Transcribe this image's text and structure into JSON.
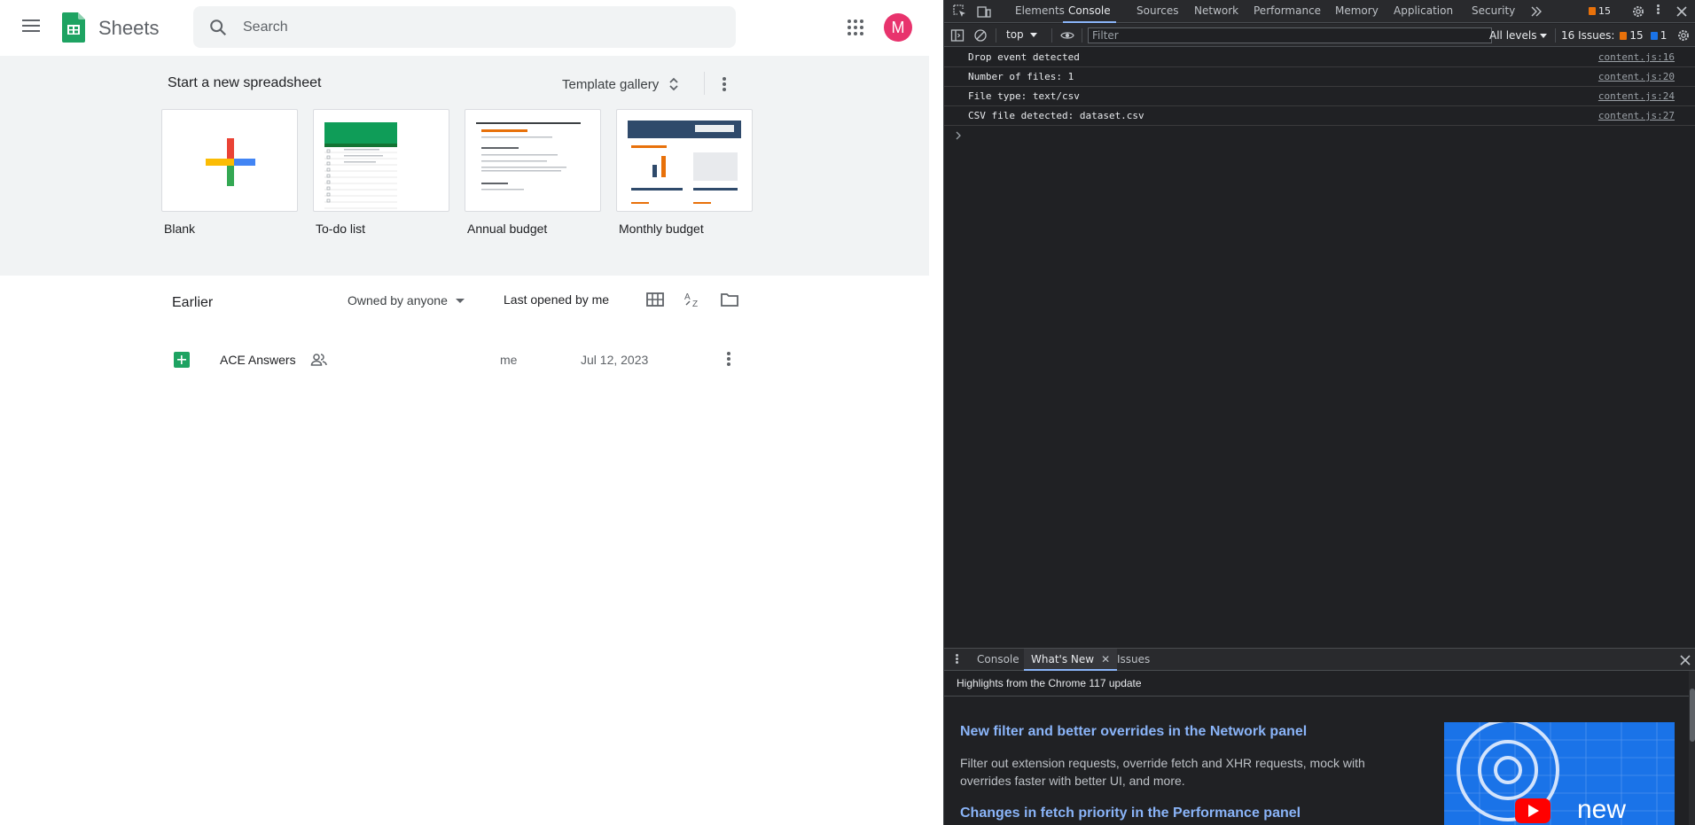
{
  "sheets": {
    "app_name": "Sheets",
    "search_placeholder": "Search",
    "avatar_initial": "M",
    "new_section": {
      "title": "Start a new spreadsheet",
      "template_gallery": "Template gallery",
      "templates": [
        {
          "label": "Blank"
        },
        {
          "label": "To-do list"
        },
        {
          "label": "Annual budget"
        },
        {
          "label": "Monthly budget"
        }
      ]
    },
    "earlier": {
      "title": "Earlier",
      "owner_filter": "Owned by anyone",
      "sort_label": "Last opened by me",
      "files": [
        {
          "name": "ACE Answers",
          "owner": "me",
          "date": "Jul 12, 2023"
        }
      ]
    },
    "colors": {
      "brand_green": "#1ea362",
      "avatar": "#e8336d"
    }
  },
  "devtools": {
    "tabs": [
      "Elements",
      "Console",
      "Sources",
      "Network",
      "Performance",
      "Memory",
      "Application",
      "Security"
    ],
    "active_tab": "Console",
    "warning_count": "15",
    "toolbar": {
      "context": "top",
      "filter_placeholder": "Filter",
      "levels": "All levels",
      "issues_label": "16 Issues:",
      "issues_warnings": "15",
      "issues_info": "1"
    },
    "console_logs": [
      {
        "message": "Drop event detected",
        "source": "content.js:16"
      },
      {
        "message": "Number of files: 1",
        "source": "content.js:20"
      },
      {
        "message": "File type: text/csv",
        "source": "content.js:24"
      },
      {
        "message": "CSV file detected: dataset.csv",
        "source": "content.js:27"
      }
    ],
    "drawer": {
      "tabs": [
        "Console",
        "What's New",
        "Issues"
      ],
      "active_tab": "What's New",
      "highlights": "Highlights from the Chrome 117 update",
      "items": [
        {
          "title": "New filter and better overrides in the Network panel",
          "body": "Filter out extension requests, override fetch and XHR requests, mock with overrides faster with better UI, and more."
        },
        {
          "title": "Changes in fetch priority in the Performance panel"
        }
      ],
      "video_text": "new"
    }
  }
}
